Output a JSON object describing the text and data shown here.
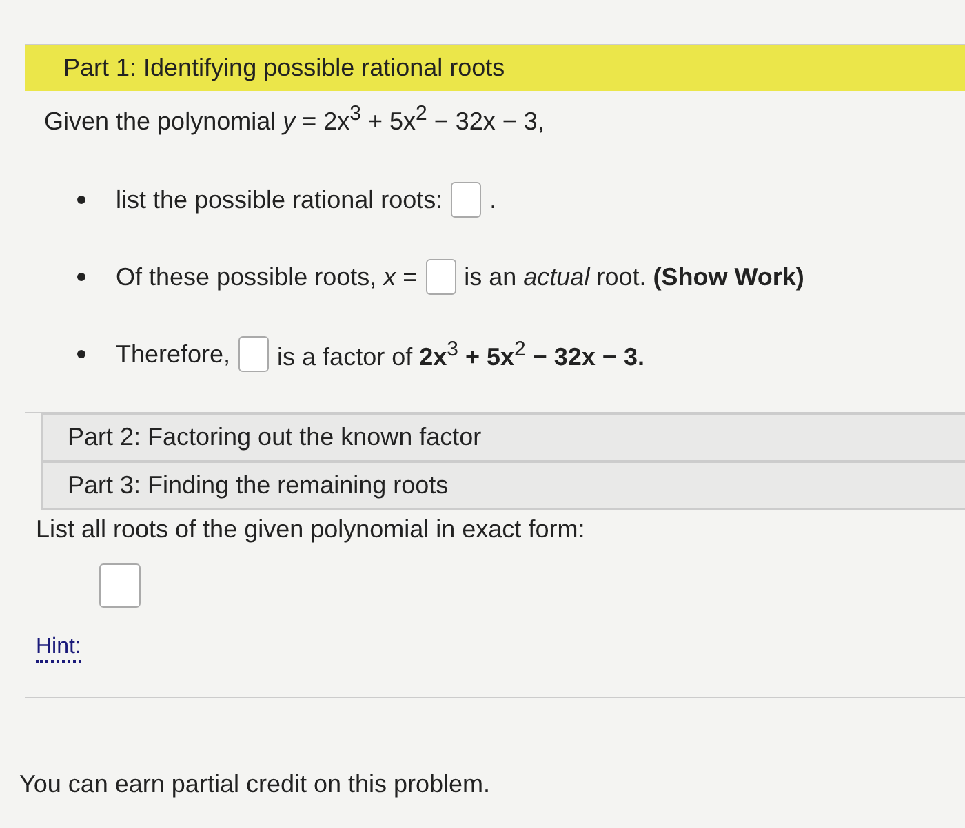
{
  "sections": [
    {
      "title": "Part 1: Identifying possible rational roots",
      "expanded": true
    },
    {
      "title": "Part 2: Factoring out the known factor",
      "expanded": false
    },
    {
      "title": "Part 3: Finding the remaining roots",
      "expanded": false
    }
  ],
  "intro": "Given the polynomial *y* = 2x$^{3}$ + 5x$^{2}$ − 32x − 3,",
  "bullets": [
    {
      "before": "list the possible rational roots:",
      "after": "."
    },
    {
      "before": "Of these possible roots, *x* =",
      "after": "is an *actual* root. **(Show Work)**"
    },
    {
      "before": "Therefore,",
      "after": "is a factor of **2x**$^{3}$ **+ 5x**$^{2}$ **− 32x − 3.**"
    }
  ],
  "roots_prompt": "List all roots of the given polynomial in exact form:",
  "hint": "Hint:",
  "footer": "You can earn partial credit on this problem."
}
